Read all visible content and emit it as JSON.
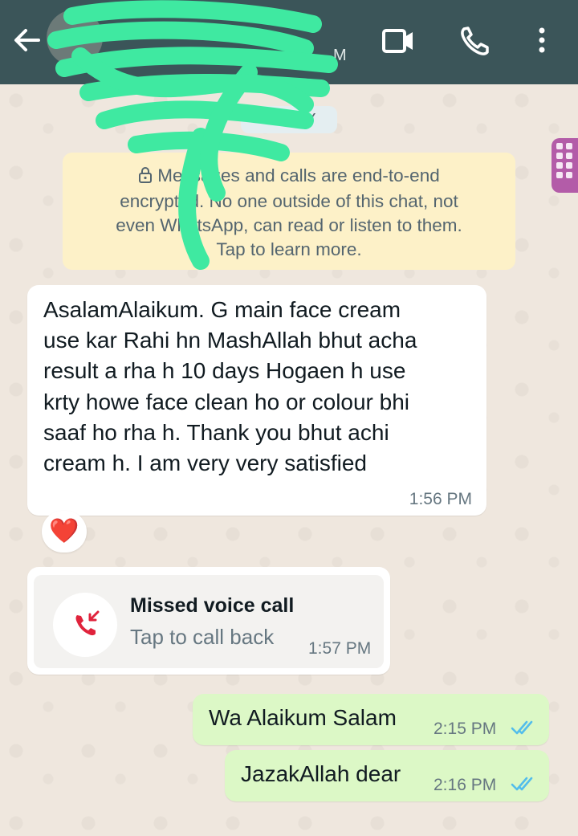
{
  "header": {
    "contact_name": "",
    "status": "M",
    "icons": [
      "back-arrow-icon",
      "avatar",
      "video-call-icon",
      "phone-icon",
      "more-vert-icon"
    ],
    "bar_color": "#3b5559"
  },
  "date_chip": "TODAY",
  "encryption_notice": {
    "line1": "Messages and calls are end-to-end",
    "line2": "encrypted. No one outside of this chat, not",
    "line3": "even WhatsApp, can read or listen to them.",
    "line4": "Tap to learn more."
  },
  "messages": [
    {
      "direction": "incoming",
      "lines": [
        "AsalamAlaikum. G main face cream",
        "use kar Rahi hn MashAllah bhut acha",
        "result a rha h 10 days Hogaen h use",
        "krty howe face clean ho or colour bhi",
        "saaf ho rha h. Thank you bhut achi",
        "cream h. I am very very satisfied"
      ],
      "time": "1:56 PM",
      "reaction": "❤️"
    },
    {
      "direction": "incoming",
      "type": "missed_call",
      "title": "Missed voice call",
      "subtitle": "Tap to call back",
      "time": "1:57 PM"
    },
    {
      "direction": "outgoing",
      "text": "Wa Alaikum Salam",
      "time": "2:15 PM",
      "status": "read"
    },
    {
      "direction": "outgoing",
      "text": "JazakAllah dear",
      "time": "2:16 PM",
      "status": "read"
    }
  ],
  "colors": {
    "incoming_bubble": "#ffffff",
    "outgoing_bubble": "#dcf8c6",
    "encryption_card": "#fdf1c8",
    "read_ticks": "#53bdeb",
    "missed_call_red": "#e0233c",
    "scribble": "#3fe9a1"
  }
}
